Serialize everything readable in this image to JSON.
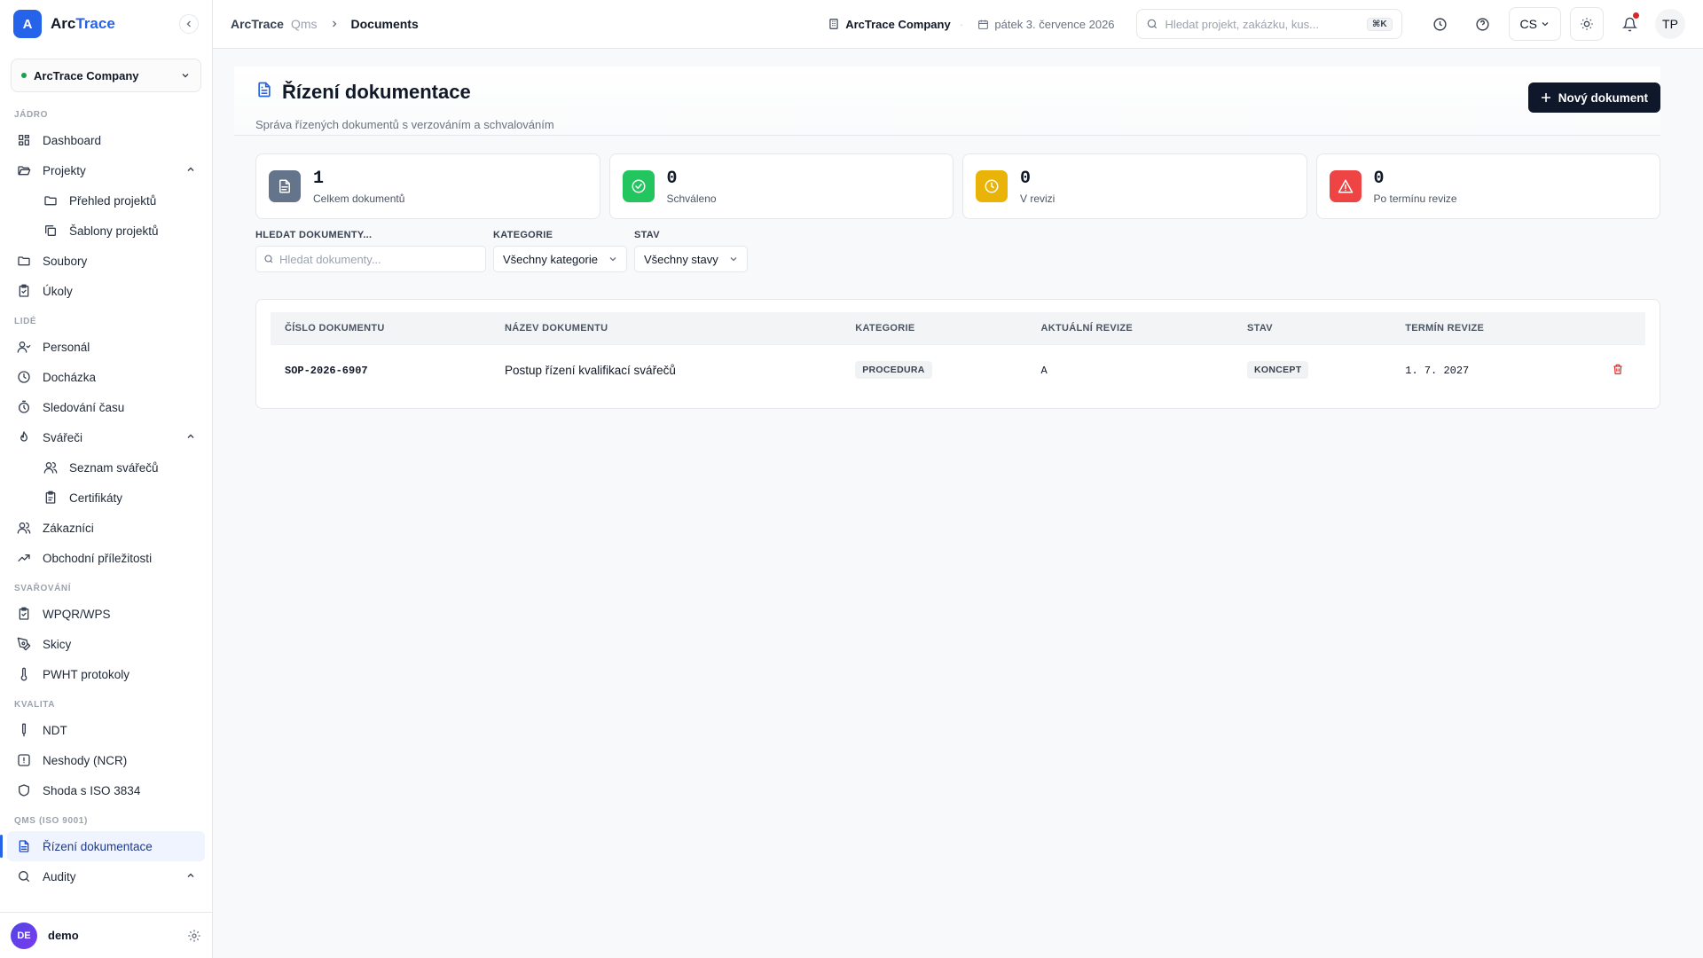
{
  "brand": {
    "logo_letter": "A",
    "name_part1": "Arc",
    "name_part2": "Trace"
  },
  "company_selector": {
    "name": "ArcTrace Company"
  },
  "sidebar": {
    "sections": [
      {
        "label": "JÁDRO",
        "items": [
          {
            "label": "Dashboard",
            "icon": "dashboard-icon"
          },
          {
            "label": "Projekty",
            "icon": "folder-open-icon",
            "expanded": true,
            "children": [
              {
                "label": "Přehled projektů",
                "icon": "folder-icon"
              },
              {
                "label": "Šablony projektů",
                "icon": "copy-icon"
              }
            ]
          },
          {
            "label": "Soubory",
            "icon": "folder-icon"
          },
          {
            "label": "Úkoly",
            "icon": "clipboard-check-icon"
          }
        ]
      },
      {
        "label": "LIDÉ",
        "items": [
          {
            "label": "Personál",
            "icon": "user-icon"
          },
          {
            "label": "Docházka",
            "icon": "clock-icon"
          },
          {
            "label": "Sledování času",
            "icon": "timer-icon"
          },
          {
            "label": "Svářeči",
            "icon": "flame-icon",
            "expanded": true,
            "children": [
              {
                "label": "Seznam svářečů",
                "icon": "users-icon"
              },
              {
                "label": "Certifikáty",
                "icon": "clipboard-icon"
              }
            ]
          },
          {
            "label": "Zákazníci",
            "icon": "users-icon"
          },
          {
            "label": "Obchodní příležitosti",
            "icon": "trending-up-icon"
          }
        ]
      },
      {
        "label": "SVAŘOVÁNÍ",
        "items": [
          {
            "label": "WPQR/WPS",
            "icon": "clipboard-check-icon"
          },
          {
            "label": "Skicy",
            "icon": "pen-tool-icon"
          },
          {
            "label": "PWHT protokoly",
            "icon": "thermometer-icon"
          }
        ]
      },
      {
        "label": "KVALITA",
        "items": [
          {
            "label": "NDT",
            "icon": "probe-icon"
          },
          {
            "label": "Neshody (NCR)",
            "icon": "alert-square-icon"
          },
          {
            "label": "Shoda s ISO 3834",
            "icon": "shield-icon"
          }
        ]
      },
      {
        "label": "QMS (ISO 9001)",
        "items": [
          {
            "label": "Řízení dokumentace",
            "icon": "file-text-icon",
            "active": true
          },
          {
            "label": "Audity",
            "icon": "search-icon",
            "expanded": true
          }
        ]
      }
    ]
  },
  "footer_user": {
    "initials": "DE",
    "name": "demo"
  },
  "topbar": {
    "breadcrumb": {
      "root": "ArcTrace",
      "mid": "Qms",
      "current": "Documents"
    },
    "company": "ArcTrace Company",
    "date": "pátek 3. července 2026",
    "search_placeholder": "Hledat projekt, zakázku, kus...",
    "search_shortcut": "⌘K",
    "lang": "CS",
    "user_initials": "TP"
  },
  "page": {
    "title": "Řízení dokumentace",
    "subtitle": "Správa řízených dokumentů s verzováním a schvalováním",
    "new_button": "Nový dokument"
  },
  "stats": [
    {
      "value": "1",
      "label": "Celkem dokumentů",
      "color": "#64748b",
      "icon": "file-icon"
    },
    {
      "value": "0",
      "label": "Schváleno",
      "color": "#22c55e",
      "icon": "check-circle-icon"
    },
    {
      "value": "0",
      "label": "V revizi",
      "color": "#eab308",
      "icon": "clock-icon"
    },
    {
      "value": "0",
      "label": "Po termínu revize",
      "color": "#ef4444",
      "icon": "alert-triangle-icon"
    }
  ],
  "filters": {
    "search_label": "HLEDAT DOKUMENTY...",
    "search_placeholder": "Hledat dokumenty...",
    "category_label": "KATEGORIE",
    "category_value": "Všechny kategorie",
    "status_label": "STAV",
    "status_value": "Všechny stavy"
  },
  "table": {
    "columns": [
      "ČÍSLO DOKUMENTU",
      "NÁZEV DOKUMENTU",
      "KATEGORIE",
      "AKTUÁLNÍ REVIZE",
      "STAV",
      "TERMÍN REVIZE"
    ],
    "rows": [
      {
        "number": "SOP-2026-6907",
        "name": "Postup řízení kvalifikací svářečů",
        "category": "PROCEDURA",
        "revision": "A",
        "status": "KONCEPT",
        "review_date": "1. 7. 2027"
      }
    ]
  }
}
